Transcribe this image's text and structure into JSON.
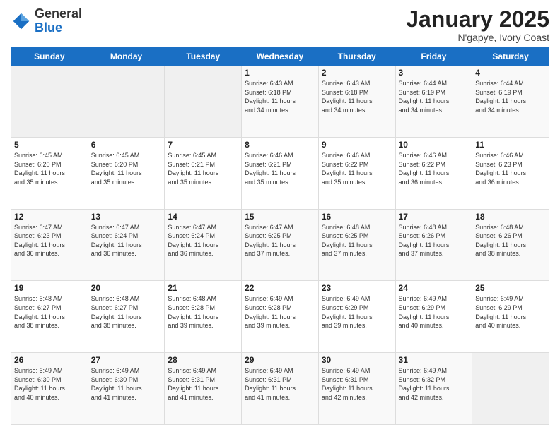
{
  "header": {
    "logo": {
      "general": "General",
      "blue": "Blue"
    },
    "title": "January 2025",
    "location": "N'gapye, Ivory Coast"
  },
  "days_of_week": [
    "Sunday",
    "Monday",
    "Tuesday",
    "Wednesday",
    "Thursday",
    "Friday",
    "Saturday"
  ],
  "weeks": [
    [
      {
        "num": "",
        "info": ""
      },
      {
        "num": "",
        "info": ""
      },
      {
        "num": "",
        "info": ""
      },
      {
        "num": "1",
        "info": "Sunrise: 6:43 AM\nSunset: 6:18 PM\nDaylight: 11 hours\nand 34 minutes."
      },
      {
        "num": "2",
        "info": "Sunrise: 6:43 AM\nSunset: 6:18 PM\nDaylight: 11 hours\nand 34 minutes."
      },
      {
        "num": "3",
        "info": "Sunrise: 6:44 AM\nSunset: 6:19 PM\nDaylight: 11 hours\nand 34 minutes."
      },
      {
        "num": "4",
        "info": "Sunrise: 6:44 AM\nSunset: 6:19 PM\nDaylight: 11 hours\nand 34 minutes."
      }
    ],
    [
      {
        "num": "5",
        "info": "Sunrise: 6:45 AM\nSunset: 6:20 PM\nDaylight: 11 hours\nand 35 minutes."
      },
      {
        "num": "6",
        "info": "Sunrise: 6:45 AM\nSunset: 6:20 PM\nDaylight: 11 hours\nand 35 minutes."
      },
      {
        "num": "7",
        "info": "Sunrise: 6:45 AM\nSunset: 6:21 PM\nDaylight: 11 hours\nand 35 minutes."
      },
      {
        "num": "8",
        "info": "Sunrise: 6:46 AM\nSunset: 6:21 PM\nDaylight: 11 hours\nand 35 minutes."
      },
      {
        "num": "9",
        "info": "Sunrise: 6:46 AM\nSunset: 6:22 PM\nDaylight: 11 hours\nand 35 minutes."
      },
      {
        "num": "10",
        "info": "Sunrise: 6:46 AM\nSunset: 6:22 PM\nDaylight: 11 hours\nand 36 minutes."
      },
      {
        "num": "11",
        "info": "Sunrise: 6:46 AM\nSunset: 6:23 PM\nDaylight: 11 hours\nand 36 minutes."
      }
    ],
    [
      {
        "num": "12",
        "info": "Sunrise: 6:47 AM\nSunset: 6:23 PM\nDaylight: 11 hours\nand 36 minutes."
      },
      {
        "num": "13",
        "info": "Sunrise: 6:47 AM\nSunset: 6:24 PM\nDaylight: 11 hours\nand 36 minutes."
      },
      {
        "num": "14",
        "info": "Sunrise: 6:47 AM\nSunset: 6:24 PM\nDaylight: 11 hours\nand 36 minutes."
      },
      {
        "num": "15",
        "info": "Sunrise: 6:47 AM\nSunset: 6:25 PM\nDaylight: 11 hours\nand 37 minutes."
      },
      {
        "num": "16",
        "info": "Sunrise: 6:48 AM\nSunset: 6:25 PM\nDaylight: 11 hours\nand 37 minutes."
      },
      {
        "num": "17",
        "info": "Sunrise: 6:48 AM\nSunset: 6:26 PM\nDaylight: 11 hours\nand 37 minutes."
      },
      {
        "num": "18",
        "info": "Sunrise: 6:48 AM\nSunset: 6:26 PM\nDaylight: 11 hours\nand 38 minutes."
      }
    ],
    [
      {
        "num": "19",
        "info": "Sunrise: 6:48 AM\nSunset: 6:27 PM\nDaylight: 11 hours\nand 38 minutes."
      },
      {
        "num": "20",
        "info": "Sunrise: 6:48 AM\nSunset: 6:27 PM\nDaylight: 11 hours\nand 38 minutes."
      },
      {
        "num": "21",
        "info": "Sunrise: 6:48 AM\nSunset: 6:28 PM\nDaylight: 11 hours\nand 39 minutes."
      },
      {
        "num": "22",
        "info": "Sunrise: 6:49 AM\nSunset: 6:28 PM\nDaylight: 11 hours\nand 39 minutes."
      },
      {
        "num": "23",
        "info": "Sunrise: 6:49 AM\nSunset: 6:29 PM\nDaylight: 11 hours\nand 39 minutes."
      },
      {
        "num": "24",
        "info": "Sunrise: 6:49 AM\nSunset: 6:29 PM\nDaylight: 11 hours\nand 40 minutes."
      },
      {
        "num": "25",
        "info": "Sunrise: 6:49 AM\nSunset: 6:29 PM\nDaylight: 11 hours\nand 40 minutes."
      }
    ],
    [
      {
        "num": "26",
        "info": "Sunrise: 6:49 AM\nSunset: 6:30 PM\nDaylight: 11 hours\nand 40 minutes."
      },
      {
        "num": "27",
        "info": "Sunrise: 6:49 AM\nSunset: 6:30 PM\nDaylight: 11 hours\nand 41 minutes."
      },
      {
        "num": "28",
        "info": "Sunrise: 6:49 AM\nSunset: 6:31 PM\nDaylight: 11 hours\nand 41 minutes."
      },
      {
        "num": "29",
        "info": "Sunrise: 6:49 AM\nSunset: 6:31 PM\nDaylight: 11 hours\nand 41 minutes."
      },
      {
        "num": "30",
        "info": "Sunrise: 6:49 AM\nSunset: 6:31 PM\nDaylight: 11 hours\nand 42 minutes."
      },
      {
        "num": "31",
        "info": "Sunrise: 6:49 AM\nSunset: 6:32 PM\nDaylight: 11 hours\nand 42 minutes."
      },
      {
        "num": "",
        "info": ""
      }
    ]
  ]
}
